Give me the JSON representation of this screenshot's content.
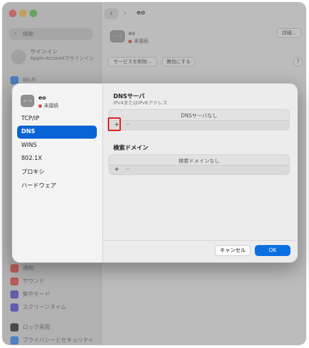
{
  "window": {
    "title": "eo",
    "nav_back": "‹",
    "nav_forward": "›"
  },
  "sidebar": {
    "search_placeholder": "検索",
    "account_title": "サインイン",
    "account_subtitle": "Apple Accountでサインイン",
    "items": [
      {
        "label": "Wi-Fi",
        "icon": "wifi-icon",
        "color": "#3b8cf0"
      },
      {
        "label": "通知",
        "icon": "bell-icon",
        "color": "#e8534b"
      },
      {
        "label": "サウンド",
        "icon": "speaker-icon",
        "color": "#e8534b"
      },
      {
        "label": "集中モード",
        "icon": "moon-icon",
        "color": "#5a55d6"
      },
      {
        "label": "スクリーンタイム",
        "icon": "hourglass-icon",
        "color": "#5a55d6"
      },
      {
        "label": "ロック画面",
        "icon": "lock-icon",
        "color": "#333333"
      },
      {
        "label": "プライバシーとセキュリティ",
        "icon": "hand-icon",
        "color": "#3b8cf0"
      }
    ]
  },
  "service": {
    "icon_glyph": "‹···›",
    "name": "eo",
    "status": "未接続",
    "details_button": "詳細...",
    "delete_button": "サービスを削除...",
    "disable_button": "無効にする",
    "help": "?"
  },
  "sheet": {
    "icon_glyph": "‹···›",
    "name": "eo",
    "status": "未接続",
    "tabs": [
      "TCP/IP",
      "DNS",
      "WINS",
      "802.1X",
      "プロキシ",
      "ハードウェア"
    ],
    "active_tab": "DNS",
    "dns": {
      "title": "DNSサーバ",
      "subtitle": "IPv4またはIPv6アドレス",
      "empty": "DNSサーバなし",
      "add": "+",
      "remove": "−"
    },
    "search_domains": {
      "title": "検索ドメイン",
      "empty": "検索ドメインなし",
      "add": "+",
      "remove": "−"
    },
    "cancel_button": "キャンセル",
    "ok_button": "OK"
  },
  "colors": {
    "accent": "#0863d6",
    "status_red": "#e0443a",
    "highlight": "#e0201b"
  }
}
